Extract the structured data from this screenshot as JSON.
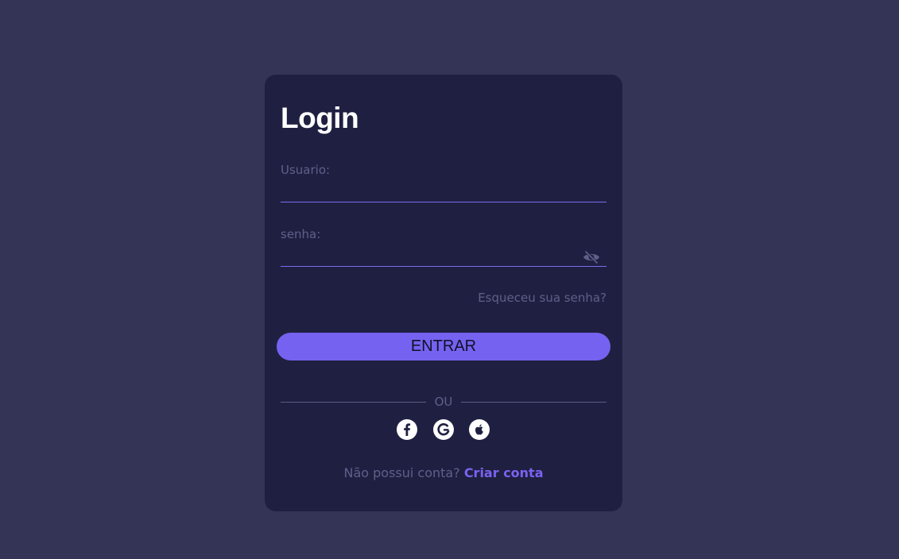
{
  "login": {
    "title": "Login",
    "username_label": "Usuario:",
    "username_value": "",
    "password_label": "senha:",
    "password_value": "",
    "forgot_link": "Esqueceu sua senha?",
    "submit_label": "ENTRAR",
    "divider_text": "OU",
    "social": [
      {
        "icon": "facebook-icon"
      },
      {
        "icon": "google-icon"
      },
      {
        "icon": "apple-icon"
      }
    ],
    "signup_prompt": "Não possui conta?",
    "signup_link": "Criar conta"
  },
  "colors": {
    "page_background": "#343457",
    "card_background": "#1f2041",
    "accent": "#7662f0",
    "muted_text": "#5f5f8a",
    "title_text": "#ffffff"
  }
}
